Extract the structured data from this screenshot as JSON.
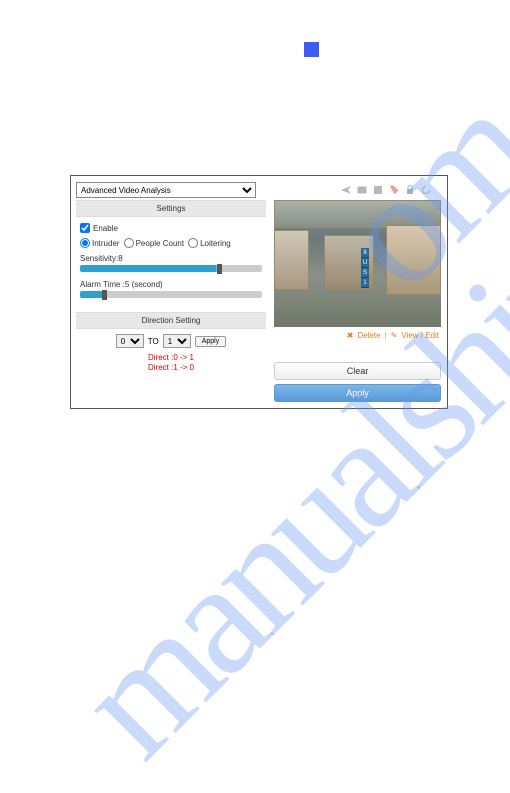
{
  "dropdown": {
    "selected": "Advanced Video Analysis"
  },
  "toolbar": {
    "icons": [
      "plane-icon",
      "photo-icon",
      "film-icon",
      "tag-icon",
      "lock-icon",
      "refresh-icon"
    ]
  },
  "settings": {
    "header": "Settings",
    "enable_label": "Enable",
    "enable_checked": true,
    "modes": {
      "intruder": "Intruder",
      "people_count": "People Count",
      "loitering": "Loitering",
      "selected": "intruder"
    },
    "sensitivity": {
      "label": "Sensitivity:8",
      "value": 8
    },
    "alarm_time": {
      "label": "Alarm Time :5 (second)",
      "value": 5
    }
  },
  "direction": {
    "header": "Direction Setting",
    "from": "0",
    "to_label": "TO",
    "to": "1",
    "apply_label": "Apply",
    "direct1": "Direct :0 -> 1",
    "direct2": "Direct :1 -> 0"
  },
  "video": {
    "indicators": [
      "8",
      "U",
      "S",
      "1"
    ],
    "delete_label": "Delete",
    "view_edit_label": "View / Edit"
  },
  "buttons": {
    "clear": "Clear",
    "apply": "Apply"
  }
}
